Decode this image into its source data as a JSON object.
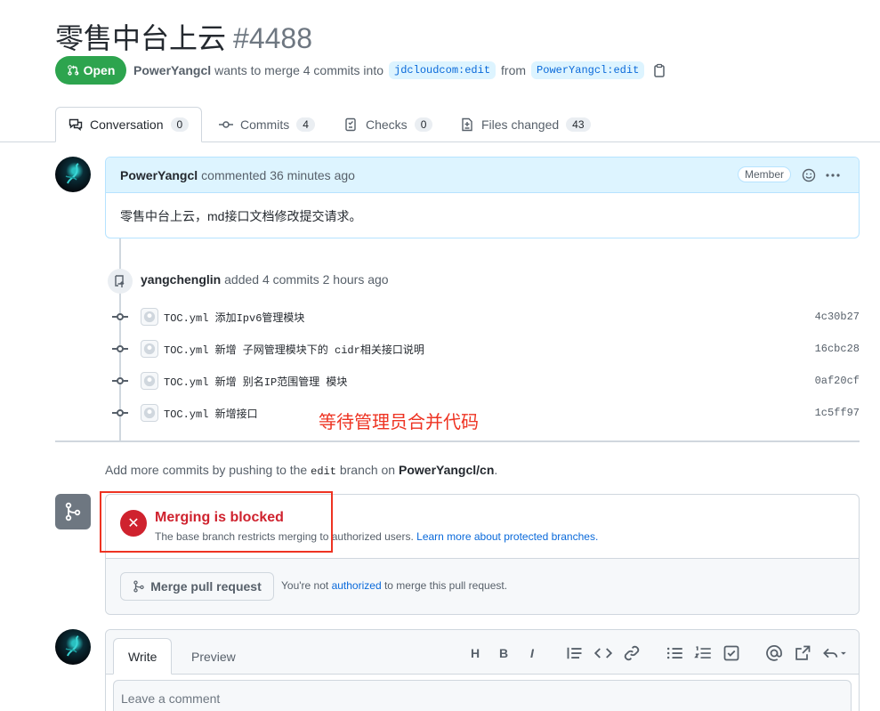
{
  "pr": {
    "title": "零售中台上云",
    "number": "#4488",
    "state": "Open",
    "author": "PowerYangcl",
    "merge_text": "wants to merge 4 commits into",
    "base_branch": "jdcloudcom:edit",
    "from_text": "from",
    "head_branch": "PowerYangcl:edit"
  },
  "tabs": [
    {
      "label": "Conversation",
      "count": "0"
    },
    {
      "label": "Commits",
      "count": "4"
    },
    {
      "label": "Checks",
      "count": "0"
    },
    {
      "label": "Files changed",
      "count": "43"
    }
  ],
  "comment": {
    "author": "PowerYangcl",
    "meta": "commented 36 minutes ago",
    "badge": "Member",
    "body": "零售中台上云，md接口文档修改提交请求。"
  },
  "commits_event": {
    "author": "yangchenglin",
    "text": "added 4 commits 2 hours ago"
  },
  "commits": [
    {
      "message": "TOC.yml 添加Ipv6管理模块",
      "sha": "4c30b27"
    },
    {
      "message": "TOC.yml 新增 子网管理模块下的 cidr相关接口说明",
      "sha": "16cbc28"
    },
    {
      "message": "TOC.yml 新增 别名IP范围管理 模块",
      "sha": "0af20cf"
    },
    {
      "message": "TOC.yml 新增接口",
      "sha": "1c5ff97"
    }
  ],
  "annotation": "等待管理员合并代码",
  "push_hint": {
    "prefix": "Add more commits by pushing to the",
    "branch": "edit",
    "middle": "branch on",
    "repo": "PowerYangcl/cn",
    "suffix": "."
  },
  "merge": {
    "title": "Merging is blocked",
    "desc": "The base branch restricts merging to authorized users.",
    "learn_more": "Learn more about protected branches.",
    "button": "Merge pull request",
    "note_prefix": "You're not",
    "note_link": "authorized",
    "note_suffix": "to merge this pull request."
  },
  "editor": {
    "write_tab": "Write",
    "preview_tab": "Preview",
    "placeholder": "Leave a comment",
    "tools": [
      "H",
      "B",
      "I"
    ]
  },
  "colors": {
    "open_green": "#2da44e",
    "blocked_red": "#cf222e",
    "annotation_red": "#ee3322",
    "link_blue": "#0969da"
  }
}
